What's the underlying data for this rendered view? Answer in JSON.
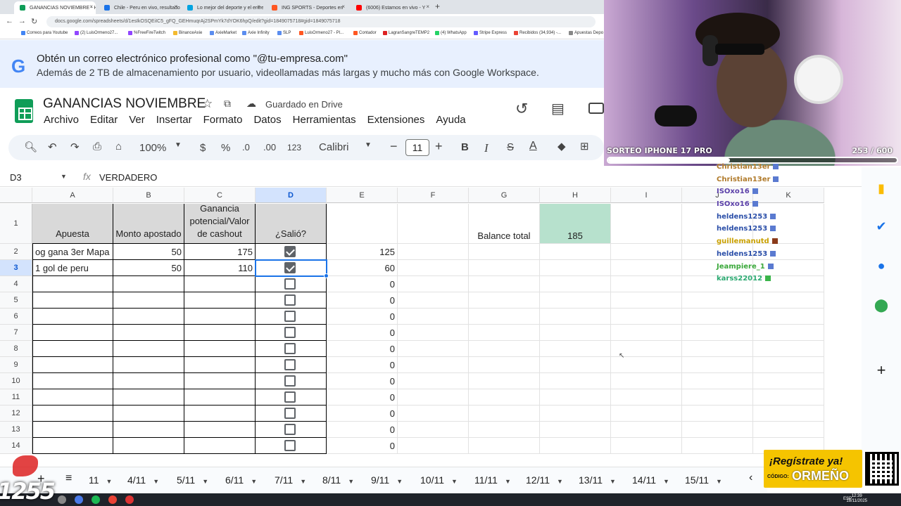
{
  "browser": {
    "tabs": [
      {
        "title": "GANANCIAS NOVIEMBRE - Hoj",
        "active": true,
        "favicon_color": "#0f9d58"
      },
      {
        "title": "Chile - Peru en vivo, resultado",
        "favicon_color": "#1a73e8"
      },
      {
        "title": "Lo mejor del deporte y el entre",
        "favicon_color": "#00a3e0"
      },
      {
        "title": "ING SPORTS - Deportes en",
        "favicon_color": "#ff5722"
      },
      {
        "title": "(6006) Estamos en vivo - Y",
        "favicon_color": "#ff0000"
      }
    ],
    "url": "docs.google.com/spreadsheets/d/1esIkOSQEiIC5_gFQ_GEHmuqrAj2SPmYk7dYOK6hpQ/edit?gid=1849075718#gid=1849075718",
    "bookmarks": [
      "Correos para Youtube",
      "(2) LuisOrmeno27...",
      "%FreeFireTwitch",
      "BinanceAxie",
      "AxieMarket",
      "Axie Infinity",
      "SLP",
      "LuisOrmeno27 - Pl...",
      "Contador",
      "LagranSangreTEMP2",
      "(4) WhatsApp",
      "Stripe Express",
      "Recibidos (34,934) -...",
      "Apuestas Depo"
    ]
  },
  "promo": {
    "logo": "G",
    "title": "Obtén un correo electrónico profesional como \"@tu-empresa.com\"",
    "subtitle": "Además de 2 TB de almacenamiento por usuario, videollamadas más largas y mucho más con Google Workspace."
  },
  "sheet": {
    "title": "GANANCIAS NOVIEMBRE",
    "saved": "Guardado en Drive",
    "menu": [
      "Archivo",
      "Editar",
      "Ver",
      "Insertar",
      "Formato",
      "Datos",
      "Herramientas",
      "Extensiones",
      "Ayuda"
    ],
    "toolbar": {
      "zoom": "100%",
      "currency": "$",
      "percent": "%",
      "dec_less": ".0",
      "dec_more": ".00",
      "format_123": "123",
      "font": "Calibri",
      "font_size": "11",
      "bold": "B",
      "italic": "I",
      "strike": "S",
      "text_color": "A"
    },
    "cell_ref": "D3",
    "formula": "VERDADERO",
    "columns": [
      "A",
      "B",
      "C",
      "D",
      "E",
      "F",
      "G",
      "H",
      "I",
      "J",
      "K"
    ],
    "rows": [
      "1",
      "2",
      "3",
      "4",
      "5",
      "6",
      "7",
      "8",
      "9",
      "10",
      "11",
      "12",
      "13",
      "14"
    ],
    "headers": {
      "apuesta": "Apuesta",
      "monto": "Monto apostado",
      "ganancia": "Ganancia potencial/Valor de cashout",
      "salio": "¿Salió?"
    },
    "balance_label": "Balance total",
    "balance_value": "185",
    "data_rows": [
      {
        "apuesta": "og gana 3er Mapa",
        "monto": "50",
        "ganancia": "175",
        "salio": true,
        "e": "125"
      },
      {
        "apuesta": "1 gol de peru",
        "monto": "50",
        "ganancia": "110",
        "salio": true,
        "e": "60"
      },
      {
        "apuesta": "",
        "monto": "",
        "ganancia": "",
        "salio": false,
        "e": "0"
      },
      {
        "apuesta": "",
        "monto": "",
        "ganancia": "",
        "salio": false,
        "e": "0"
      },
      {
        "apuesta": "",
        "monto": "",
        "ganancia": "",
        "salio": false,
        "e": "0"
      },
      {
        "apuesta": "",
        "monto": "",
        "ganancia": "",
        "salio": false,
        "e": "0"
      },
      {
        "apuesta": "",
        "monto": "",
        "ganancia": "",
        "salio": false,
        "e": "0"
      },
      {
        "apuesta": "",
        "monto": "",
        "ganancia": "",
        "salio": false,
        "e": "0"
      },
      {
        "apuesta": "",
        "monto": "",
        "ganancia": "",
        "salio": false,
        "e": "0"
      },
      {
        "apuesta": "",
        "monto": "",
        "ganancia": "",
        "salio": false,
        "e": "0"
      },
      {
        "apuesta": "",
        "monto": "",
        "ganancia": "",
        "salio": false,
        "e": "0"
      },
      {
        "apuesta": "",
        "monto": "",
        "ganancia": "",
        "salio": false,
        "e": "0"
      },
      {
        "apuesta": "",
        "monto": "",
        "ganancia": "",
        "salio": false,
        "e": "0"
      }
    ],
    "sheet_tabs": [
      "11",
      "4/11",
      "5/11",
      "6/11",
      "7/11",
      "8/11",
      "9/11",
      "10/11",
      "11/11",
      "12/11",
      "13/11",
      "14/11",
      "15/11"
    ]
  },
  "stream": {
    "raffle_label": "SORTEO IPHONE 17 PRO",
    "raffle_count": "253 / 600",
    "raffle_progress": 0.4217,
    "chat": [
      {
        "user": "Christian13er",
        "color": "#b07a2a"
      },
      {
        "user": "Christian13er",
        "color": "#b07a2a"
      },
      {
        "user": "ISOxo16",
        "color": "#5a3fa8"
      },
      {
        "user": "ISOxo16",
        "color": "#5a3fa8"
      },
      {
        "user": "heldens1253",
        "color": "#2a4ea8"
      },
      {
        "user": "heldens1253",
        "color": "#2a4ea8"
      },
      {
        "user": "guillemanutd",
        "color": "#c9a000"
      },
      {
        "user": "heldens1253",
        "color": "#2a4ea8"
      },
      {
        "user": "Jeampiere_1",
        "color": "#3aa83a"
      },
      {
        "user": "karss22012",
        "color": "#2aa870"
      }
    ],
    "register_title": "¡Regístrate ya!",
    "code_label": "CÓDIGO:",
    "code_value": "ORMEÑO",
    "watermark": "1255"
  },
  "taskbar": {
    "lang": "ESP",
    "time": "12:39",
    "date": "18/11/2025"
  }
}
